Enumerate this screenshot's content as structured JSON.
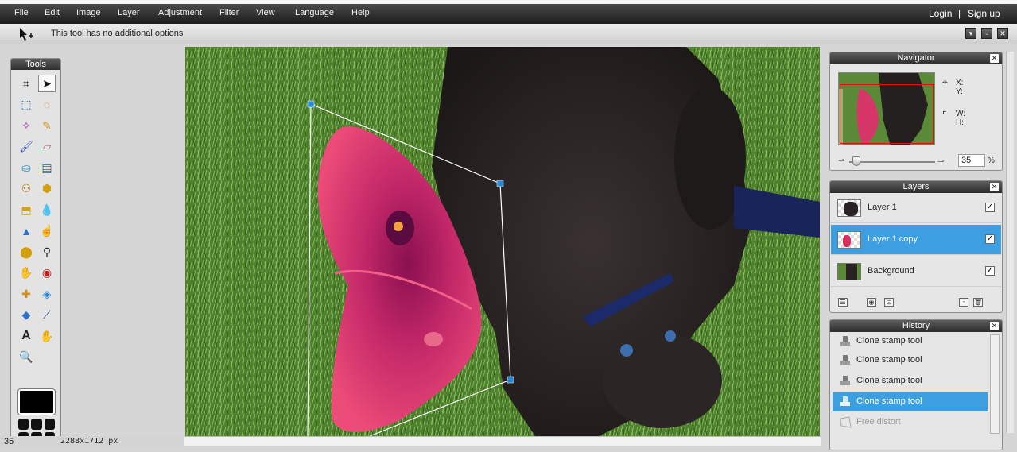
{
  "menubar": {
    "items": [
      "File",
      "Edit",
      "Image",
      "Layer",
      "Adjustment",
      "Filter",
      "View",
      "Language",
      "Help"
    ],
    "login": "Login",
    "separator": "|",
    "signup": "Sign up"
  },
  "optionsbar": {
    "message": "This tool has no additional options",
    "active_tool_icon": "move-tool-icon"
  },
  "tools": {
    "title": "Tools",
    "items": [
      "crop",
      "move",
      "marquee",
      "lasso",
      "magic-wand",
      "pencil",
      "brush",
      "eraser",
      "bucket",
      "gradient",
      "clone-stamp",
      "color-replace",
      "drawing",
      "blur",
      "sharpen",
      "smudge",
      "sponge",
      "dodge",
      "burn",
      "red-eye",
      "spot-heal",
      "bloat",
      "pinch",
      "color-picker",
      "type",
      "hand",
      "zoom"
    ],
    "foreground_color": "#000000"
  },
  "status": {
    "zoom": "35",
    "size": "2288x1712 px"
  },
  "navigator": {
    "title": "Navigator",
    "x_label": "X:",
    "y_label": "Y:",
    "w_label": "W:",
    "h_label": "H:",
    "zoom_value": "35",
    "zoom_unit": "%"
  },
  "layers": {
    "title": "Layers",
    "items": [
      {
        "name": "Layer 1",
        "visible": true,
        "selected": false
      },
      {
        "name": "Layer 1 copy",
        "visible": true,
        "selected": true
      },
      {
        "name": "Background",
        "visible": true,
        "selected": false
      }
    ]
  },
  "history": {
    "title": "History",
    "items": [
      {
        "label": "Clone stamp tool",
        "state": "done"
      },
      {
        "label": "Clone stamp tool",
        "state": "done"
      },
      {
        "label": "Clone stamp tool",
        "state": "done"
      },
      {
        "label": "Clone stamp tool",
        "state": "selected"
      },
      {
        "label": "Free distort",
        "state": "future"
      }
    ]
  },
  "colors": {
    "accent": "#3d9ee0",
    "panel_title": "#2e2e2e",
    "grass": "#4a7a2a",
    "kitten": "#2a2424",
    "wing": "#e0356a"
  }
}
